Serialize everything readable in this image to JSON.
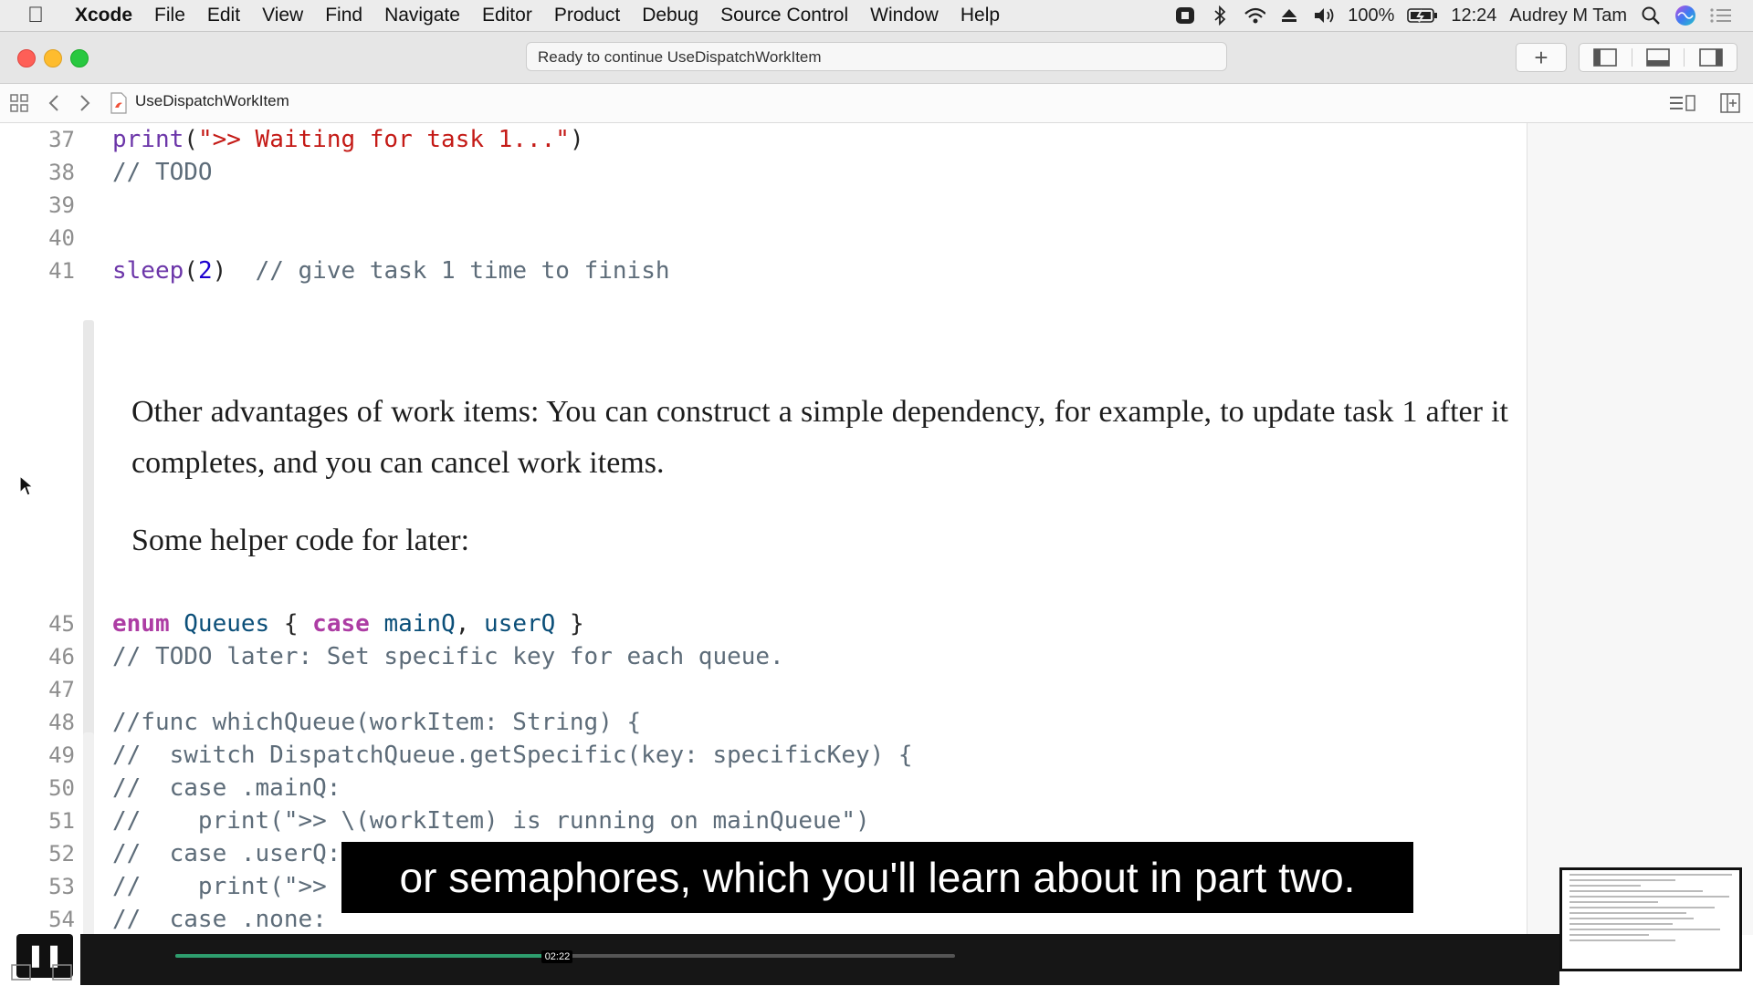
{
  "menubar": {
    "app": "Xcode",
    "items": [
      "File",
      "Edit",
      "View",
      "Find",
      "Navigate",
      "Editor",
      "Product",
      "Debug",
      "Source Control",
      "Window",
      "Help"
    ],
    "battery": "100%",
    "time": "12:24",
    "user": "Audrey M Tam"
  },
  "window": {
    "activity": "Ready to continue UseDispatchWorkItem",
    "jump_file": "UseDispatchWorkItem"
  },
  "code_top": [
    {
      "ln": "37",
      "segments": [
        {
          "t": "print",
          "c": "fn"
        },
        {
          "t": "(",
          "c": ""
        },
        {
          "t": "\">> Waiting for task 1...\"",
          "c": "str"
        },
        {
          "t": ")",
          "c": ""
        }
      ]
    },
    {
      "ln": "38",
      "segments": [
        {
          "t": "// TODO",
          "c": "cm"
        }
      ]
    },
    {
      "ln": "39",
      "segments": []
    },
    {
      "ln": "40",
      "segments": []
    },
    {
      "ln": "41",
      "segments": [
        {
          "t": "sleep",
          "c": "fn"
        },
        {
          "t": "(",
          "c": ""
        },
        {
          "t": "2",
          "c": "num"
        },
        {
          "t": ")  ",
          "c": ""
        },
        {
          "t": "// give task 1 time to finish",
          "c": "cm"
        }
      ]
    }
  ],
  "prose": {
    "paragraph1": "Other advantages of work items: You can construct a simple dependency, for example, to update task 1 after it completes, and you can cancel work items.",
    "paragraph2": "Some helper code for later:"
  },
  "code_bottom": [
    {
      "ln": "45",
      "segments": [
        {
          "t": "enum",
          "c": "kw"
        },
        {
          "t": " ",
          "c": ""
        },
        {
          "t": "Queues",
          "c": "ty"
        },
        {
          "t": " { ",
          "c": ""
        },
        {
          "t": "case",
          "c": "kw"
        },
        {
          "t": " ",
          "c": ""
        },
        {
          "t": "mainQ",
          "c": "ty"
        },
        {
          "t": ", ",
          "c": ""
        },
        {
          "t": "userQ",
          "c": "ty"
        },
        {
          "t": " }",
          "c": ""
        }
      ]
    },
    {
      "ln": "46",
      "segments": [
        {
          "t": "// TODO later: Set specific key for each queue.",
          "c": "cm"
        }
      ]
    },
    {
      "ln": "47",
      "segments": []
    },
    {
      "ln": "48",
      "segments": [
        {
          "t": "//func whichQueue(workItem: String) {",
          "c": "cm"
        }
      ]
    },
    {
      "ln": "49",
      "segments": [
        {
          "t": "//  switch DispatchQueue.getSpecific(key: specificKey) {",
          "c": "cm"
        }
      ]
    },
    {
      "ln": "50",
      "segments": [
        {
          "t": "//  case .mainQ:",
          "c": "cm"
        }
      ]
    },
    {
      "ln": "51",
      "segments": [
        {
          "t": "//    print(\">> \\(workItem) is running on mainQueue\")",
          "c": "cm"
        }
      ]
    },
    {
      "ln": "52",
      "segments": [
        {
          "t": "//  case .userQ:",
          "c": "cm"
        }
      ]
    },
    {
      "ln": "53",
      "segments": [
        {
          "t": "//    print(\">> \\(workItem) is running on userQueue\")",
          "c": "cm"
        }
      ]
    },
    {
      "ln": "54",
      "segments": [
        {
          "t": "//  case .none:",
          "c": "cm"
        }
      ]
    }
  ],
  "video": {
    "caption": "or semaphores, which you'll learn about in part two.",
    "time_tooltip": "02:22",
    "progress": 0.49,
    "pause_icon": "pause-icon"
  },
  "colors": {
    "keyword": "#ad3da4",
    "string": "#c41a16",
    "number": "#1c00cf",
    "comment": "#5d6c79",
    "progress": "#2e9e6e"
  }
}
